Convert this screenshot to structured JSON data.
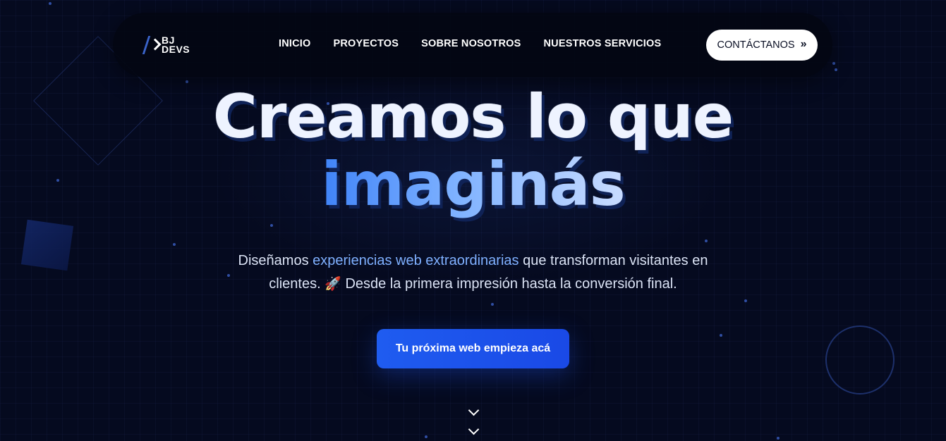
{
  "brand": {
    "logo_line1": "BJ",
    "logo_line2": "DEVS"
  },
  "nav": {
    "items": [
      {
        "label": "INICIO"
      },
      {
        "label": "PROYECTOS"
      },
      {
        "label": "SOBRE NOSOTROS"
      },
      {
        "label": "NUESTROS SERVICIOS"
      }
    ],
    "contact_label": "CONTÁCTANOS",
    "contact_icon": "double-chevron-right-icon"
  },
  "hero": {
    "title_line1": "Creamos lo que",
    "title_line2": "imaginás",
    "subtitle_part1": "Diseñamos ",
    "subtitle_highlight": "experiencias web extraordinarias",
    "subtitle_part2": " que transforman visitantes en clientes. ",
    "subtitle_emoji": "🚀",
    "subtitle_part3": " Desde la primera impresión hasta la conversión final.",
    "cta_label": "Tu próxima web empieza acá",
    "scroll_icon": "chevron-down-icon"
  },
  "colors": {
    "background": "#050a1f",
    "accent": "#1f5cf0",
    "highlight_text": "#7fb0ff",
    "title_gradient_start": "#3f83f8",
    "title_gradient_end": "#c9dcff"
  }
}
